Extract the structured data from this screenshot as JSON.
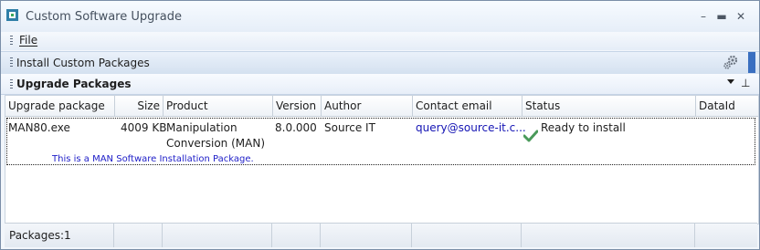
{
  "window": {
    "title": "Custom Software Upgrade"
  },
  "menu": {
    "file": "File"
  },
  "toolbar": {
    "label": "Install Custom Packages"
  },
  "section": {
    "title": "Upgrade Packages"
  },
  "grid": {
    "columns": [
      "Upgrade package",
      "Size",
      "Product",
      "Version",
      "Author",
      "Contact email",
      "Status",
      "DataId"
    ],
    "rows": [
      {
        "package": "MAN80.exe",
        "size": "4009 KB",
        "product_line1": "Manipulation",
        "product_line2": "Conversion (MAN)",
        "version": "8.0.000",
        "author": "Source IT",
        "email": "query@source-it.c...",
        "status": "Ready to install",
        "dataid": "",
        "description": "This is a MAN Software Installation Package."
      }
    ]
  },
  "footer": {
    "count": "Packages:1"
  },
  "colors": {
    "accent": "#3a6fc0",
    "link": "#1414b4",
    "check": "#4a9a5a"
  }
}
